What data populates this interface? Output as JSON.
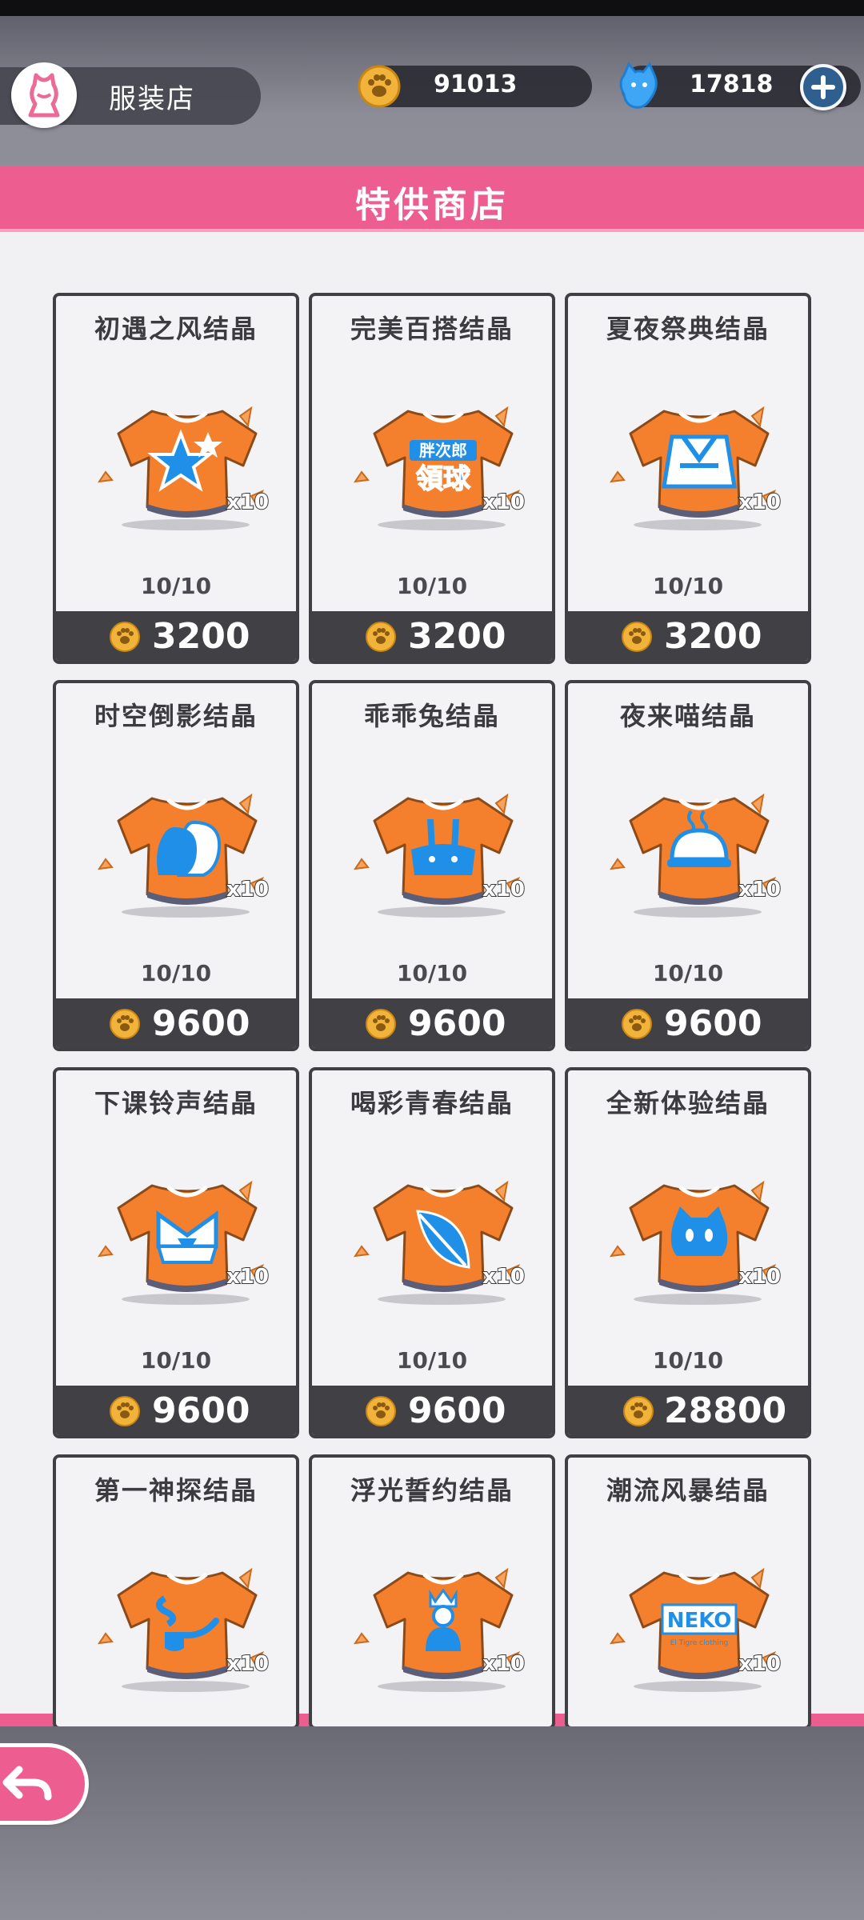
{
  "header": {
    "shop_name": "服装店",
    "paw_coins": "91013",
    "gems": "17818",
    "shop_icon": "dress-icon",
    "paw_icon": "paw-coin-icon",
    "gem_icon": "blue-ghost-gem-icon",
    "add_icon": "plus-icon"
  },
  "banner": {
    "title": "特供商店"
  },
  "colors": {
    "accent_pink": "#ee5d8f",
    "shirt_orange": "#f47f2c",
    "emblem_blue": "#1f8fe8",
    "dark_bar": "#404045"
  },
  "items": [
    {
      "name": "初遇之风结晶",
      "qty": "x10",
      "stock": "10/10",
      "price": "3200",
      "emblem": "star"
    },
    {
      "name": "完美百搭结晶",
      "qty": "x10",
      "stock": "10/10",
      "price": "3200",
      "emblem": "text",
      "emblem_lines": [
        "胖次郎",
        "領球"
      ]
    },
    {
      "name": "夏夜祭典结晶",
      "qty": "x10",
      "stock": "10/10",
      "price": "3200",
      "emblem": "kimono"
    },
    {
      "name": "时空倒影结晶",
      "qty": "x10",
      "stock": "10/10",
      "price": "9600",
      "emblem": "silhouettes"
    },
    {
      "name": "乖乖兔结晶",
      "qty": "x10",
      "stock": "10/10",
      "price": "9600",
      "emblem": "rabbit"
    },
    {
      "name": "夜来喵结晶",
      "qty": "x10",
      "stock": "10/10",
      "price": "9600",
      "emblem": "cloche"
    },
    {
      "name": "下课铃声结晶",
      "qty": "x10",
      "stock": "10/10",
      "price": "9600",
      "emblem": "uniform"
    },
    {
      "name": "喝彩青春结晶",
      "qty": "x10",
      "stock": "10/10",
      "price": "9600",
      "emblem": "leaf"
    },
    {
      "name": "全新体验结晶",
      "qty": "x10",
      "stock": "10/10",
      "price": "28800",
      "emblem": "cat"
    },
    {
      "name": "第一神探结晶",
      "qty": "x10",
      "stock": "",
      "price": "",
      "emblem": "pipe"
    },
    {
      "name": "浮光誓约结晶",
      "qty": "x10",
      "stock": "",
      "price": "",
      "emblem": "queen"
    },
    {
      "name": "潮流风暴结晶",
      "qty": "x10",
      "stock": "",
      "price": "",
      "emblem": "brand",
      "emblem_lines": [
        "NEKO",
        "El Tigre clothing"
      ]
    }
  ],
  "footer": {
    "back_icon": "back-arrow-icon"
  }
}
